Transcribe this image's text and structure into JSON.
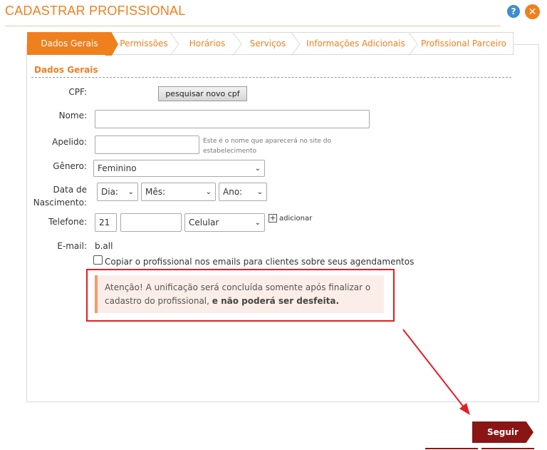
{
  "header": {
    "title": "CADASTRAR PROFISSIONAL"
  },
  "tabs": [
    {
      "label": "Dados Gerais",
      "active": true
    },
    {
      "label": "Permissões"
    },
    {
      "label": "Horários"
    },
    {
      "label": "Serviços"
    },
    {
      "label": "Informações Adicionais"
    },
    {
      "label": "Profissional Parceiro"
    }
  ],
  "section": {
    "title": "Dados Gerais"
  },
  "form": {
    "cpf_label": "CPF:",
    "cpf_button": "pesquisar novo cpf",
    "nome_label": "Nome:",
    "nome_value": "",
    "apelido_label": "Apelido:",
    "apelido_value": "",
    "apelido_hint": "Este é o nome que aparecerá no site do estabelecimento",
    "genero_label": "Gênero:",
    "genero_value": "Feminino",
    "nascimento_label_1": "Data de",
    "nascimento_label_2": "Nascimento:",
    "dia_value": "Dia:",
    "mes_value": "Mês:",
    "ano_value": "Ano:",
    "telefone_label": "Telefone:",
    "ddd_value": "21",
    "phone_value": "",
    "phone_type": "Celular",
    "add_label": "adicionar",
    "email_label": "E-mail:",
    "email_value": "b.all",
    "copy_checkbox_label": "Copiar o profissional nos emails para clientes sobre seus agendamentos"
  },
  "alert": {
    "text": "Atenção! A unificação será concluída somente após finalizar o cadastro do profissional, ",
    "bold": "e não poderá ser desfeita."
  },
  "actions": {
    "next_label": "Seguir"
  },
  "colors": {
    "accent": "#f07f1e",
    "danger": "#e31e24",
    "button": "#8a1515"
  }
}
